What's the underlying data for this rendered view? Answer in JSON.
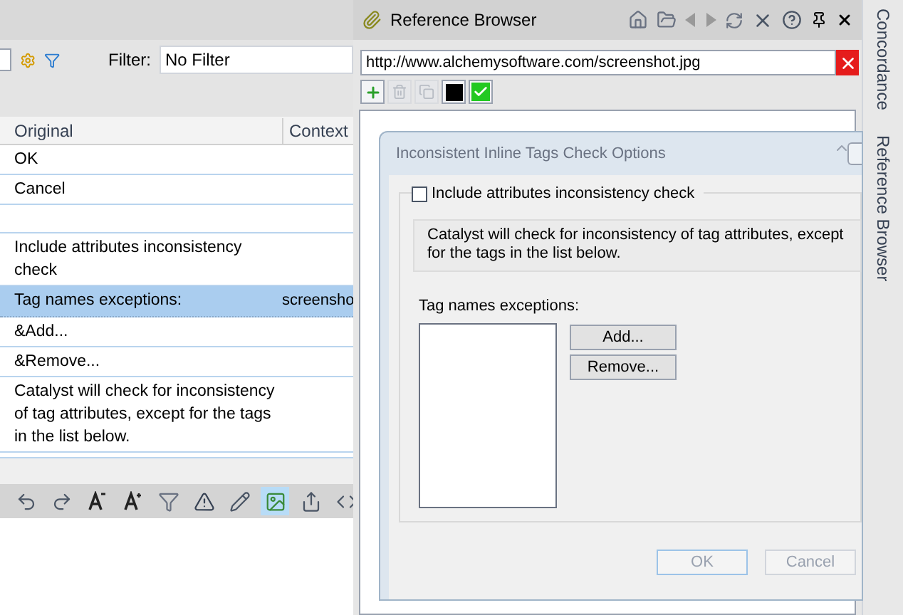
{
  "editor": {
    "filter_label": "Filter:",
    "filter_value": "No Filter",
    "table": {
      "columns": [
        "Original",
        "Context"
      ],
      "rows": [
        {
          "original": "OK",
          "context": "",
          "selected": false
        },
        {
          "original": "Cancel",
          "context": "",
          "selected": false
        },
        {
          "original": "",
          "context": "",
          "selected": false
        },
        {
          "original": "Include attributes inconsistency check",
          "context": "",
          "selected": false
        },
        {
          "original": "Tag names exceptions:",
          "context": "screensho",
          "selected": true
        },
        {
          "original": "&Add...",
          "context": "",
          "selected": false
        },
        {
          "original": "&Remove...",
          "context": "",
          "selected": false
        },
        {
          "original": "Catalyst will check for inconsistency of tag attributes, except for the tags in the list below.",
          "context": "",
          "selected": false
        }
      ]
    },
    "bottom_toolbar": [
      {
        "kind": "undo",
        "selected": false
      },
      {
        "kind": "redo",
        "selected": false
      },
      {
        "kind": "font-smaller",
        "selected": false
      },
      {
        "kind": "font-larger",
        "selected": false
      },
      {
        "kind": "filter",
        "selected": false
      },
      {
        "kind": "warning",
        "selected": false
      },
      {
        "kind": "edit",
        "selected": false
      },
      {
        "kind": "image",
        "selected": true
      },
      {
        "kind": "export",
        "selected": false
      },
      {
        "kind": "tag",
        "selected": false
      }
    ]
  },
  "reference_browser": {
    "title": "Reference Browser",
    "url": "http://www.alchemysoftware.com/screenshot.jpg",
    "tools": [
      {
        "kind": "add",
        "disabled": false
      },
      {
        "kind": "remove",
        "disabled": true
      },
      {
        "kind": "copy",
        "disabled": true
      },
      {
        "kind": "color",
        "disabled": false
      },
      {
        "kind": "check",
        "disabled": false
      }
    ],
    "preview": {
      "title": "Inconsistent Inline Tags Check Options",
      "checkbox": {
        "label": "Include attributes inconsistency check",
        "checked": false
      },
      "info": "Catalyst will check for inconsistency of tag attributes, except for the tags in the list below.",
      "list_label": "Tag names exceptions:",
      "list_buttons": [
        "Add...",
        "Remove..."
      ],
      "footer_buttons": [
        "OK",
        "Cancel"
      ]
    }
  },
  "side_tabs": [
    "Concordance",
    "Reference Browser"
  ]
}
